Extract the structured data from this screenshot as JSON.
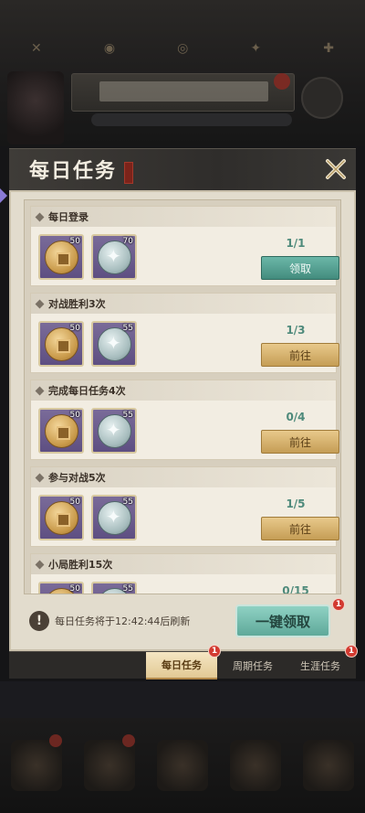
{
  "dialog": {
    "title": "每日任务",
    "close_icon": "close-x-icon"
  },
  "colors": {
    "claim_button": "#4f9a8b",
    "go_button": "#d9b673",
    "badge": "#d23a30",
    "progress_text": "#4e8a7b"
  },
  "tasks": [
    {
      "name": "每日登录",
      "rewards": [
        {
          "icon": "gold-coin-icon",
          "count": "50"
        },
        {
          "icon": "silver-coin-icon",
          "count": "70"
        }
      ],
      "progress": "1/1",
      "action": "领取",
      "action_type": "claim"
    },
    {
      "name": "对战胜利3次",
      "rewards": [
        {
          "icon": "gold-coin-icon",
          "count": "50"
        },
        {
          "icon": "silver-coin-icon",
          "count": "55"
        }
      ],
      "progress": "1/3",
      "action": "前往",
      "action_type": "go"
    },
    {
      "name": "完成每日任务4次",
      "rewards": [
        {
          "icon": "gold-coin-icon",
          "count": "50"
        },
        {
          "icon": "silver-coin-icon",
          "count": "55"
        }
      ],
      "progress": "0/4",
      "action": "前往",
      "action_type": "go"
    },
    {
      "name": "参与对战5次",
      "rewards": [
        {
          "icon": "gold-coin-icon",
          "count": "50"
        },
        {
          "icon": "silver-coin-icon",
          "count": "55"
        }
      ],
      "progress": "1/5",
      "action": "前往",
      "action_type": "go"
    },
    {
      "name": "小局胜利15次",
      "rewards": [
        {
          "icon": "gold-coin-icon",
          "count": "50"
        },
        {
          "icon": "silver-coin-icon",
          "count": "55"
        }
      ],
      "progress": "0/15",
      "action": "",
      "action_type": "go"
    }
  ],
  "footer": {
    "notice_icon": "!",
    "notice": "每日任务将于12:42:44后刷新",
    "claim_all_label": "一键领取",
    "claim_all_badge": "1"
  },
  "tabs": [
    {
      "label": "每日任务",
      "badge": "1",
      "active": true
    },
    {
      "label": "周期任务",
      "badge": "",
      "active": false
    },
    {
      "label": "生涯任务",
      "badge": "1",
      "active": false
    }
  ]
}
